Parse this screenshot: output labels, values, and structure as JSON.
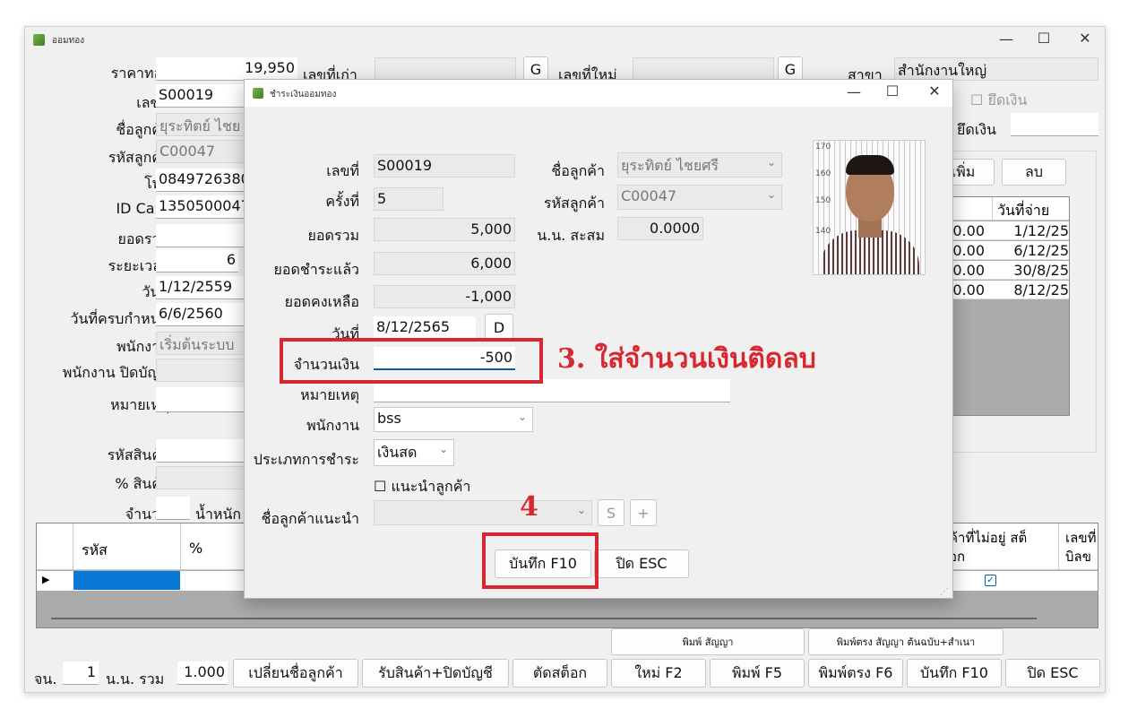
{
  "main": {
    "title": "ออมทอง",
    "labels": {
      "gold_price": "ราคาทอง",
      "doc_no": "เลขที่",
      "customer_name": "ชื่อลูกค้า",
      "customer_code": "รหัสลูกค้า",
      "phone": "โทร",
      "id_card": "ID Card",
      "total": "ยอดรวม",
      "period": "ระยะเวลา",
      "date": "วันที่",
      "due_date": "วันที่ครบกำหนด",
      "employee": "พนักงาน",
      "closing_employee": "พนักงาน ปิดบัญชี",
      "note": "หมายเหตุ",
      "product_code": "รหัสสินค้า",
      "product_pct": "% สินค้า",
      "quantity": "จำนวน",
      "weight": "น้ำหนัก",
      "old_no": "เลขที่เก่า",
      "new_no": "เลขที่ใหม่",
      "branch": "สาขา",
      "hold_money": "ยึดเงิน",
      "hold_money2": "ยึดเงิน"
    },
    "values": {
      "gold_price": "19,950",
      "doc_no": "S00019",
      "customer_name": "ยุระทิตย์ ไชย",
      "customer_code": "C00047",
      "phone": "0849726380",
      "id_card": "1350500047",
      "period": "6",
      "date": "1/12/2559",
      "due_date": "6/6/2560",
      "employee": "เริ่มต้นระบบ",
      "branch": "สำนักงานใหญ่"
    },
    "g_label": "G",
    "add_button": "เพิ่ม",
    "delete_button": "ลบ",
    "pay_table": {
      "header": "วันที่จ่าย",
      "rows": [
        {
          "amount": "0.00",
          "date": "1/12/25"
        },
        {
          "amount": "0.00",
          "date": "6/12/25"
        },
        {
          "amount": "0.00",
          "date": "30/8/25"
        },
        {
          "amount": "0.00",
          "date": "8/12/25"
        }
      ]
    },
    "grid": {
      "col_code": "รหัส",
      "col_pct": "%",
      "col_not_in_stock": "ค้าที่ไม่อยู่ สต็อก",
      "col_bill_no": "เลขที่ บิลข"
    },
    "footer": {
      "count_label": "จน.",
      "count_value": "1",
      "weight_label": "น.น. รวม",
      "weight_value": "1.000",
      "change_customer": "เปลี่ยนชื่อลูกค้า",
      "receive_close": "รับสินค้า+ปิดบัญชี",
      "cut_stock": "ตัดสต็อก",
      "new": "ใหม่ F2",
      "print": "พิมพ์ F5",
      "print_direct": "พิมพ์ตรง F6",
      "save": "บันทึก F10",
      "close": "ปิด ESC",
      "print_contract": "พิมพ์ สัญญา",
      "print_direct_contract": "พิมพ์ตรง สัญญา ต้นฉบับ+สำเนา"
    }
  },
  "dialog": {
    "title": "ชำระเงินออมทอง",
    "labels": {
      "doc_no": "เลขที่",
      "times": "ครั้งที่",
      "total": "ยอดรวม",
      "paid": "ยอดชำระแล้ว",
      "remaining": "ยอดคงเหลือ",
      "date": "วันที่",
      "amount": "จำนวนเงิน",
      "note": "หมายเหตุ",
      "employee": "พนักงาน",
      "payment_type": "ประเภทการชำระ",
      "referral": "แนะนำลูกค้า",
      "referrer_name": "ชื่อลูกค้าแนะนำ",
      "customer_name": "ชื่อลูกค้า",
      "customer_code": "รหัสลูกค้า",
      "accum_weight": "น.น. สะสม"
    },
    "values": {
      "doc_no": "S00019",
      "times": "5",
      "total": "5,000",
      "paid": "6,000",
      "remaining": "-1,000",
      "date": "8/12/2565",
      "amount": "-500",
      "employee": "bss",
      "payment_type": "เงินสด",
      "customer_name": "ยุระทิตย์ ไชยศรี",
      "customer_code": "C00047",
      "accum_weight": "0.0000"
    },
    "d_button": "D",
    "s_button": "S",
    "plus_button": "+",
    "save_button": "บันทึก F10",
    "close_button": "ปิด ESC",
    "photo_scale": [
      "170",
      "160",
      "150",
      "140"
    ]
  },
  "annotations": {
    "step3": "3. ใส่จำนวนเงินติดลบ",
    "step4": "4"
  },
  "colors": {
    "annotation_red": "#d7282f",
    "window_bg": "#f0f0f0",
    "grid_select": "#0a78d7"
  }
}
